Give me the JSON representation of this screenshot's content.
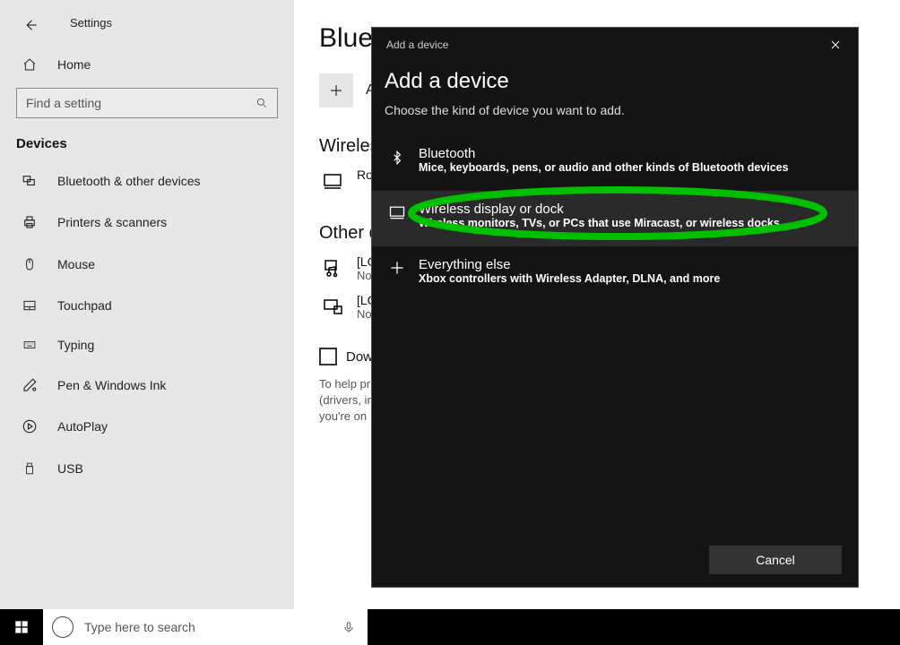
{
  "header": {
    "settings_label": "Settings",
    "home_label": "Home",
    "search_placeholder": "Find a setting",
    "section_label": "Devices"
  },
  "sidebar_items": [
    {
      "name": "bluetooth",
      "label": "Bluetooth & other devices",
      "icon": "bluetooth-mixed-icon"
    },
    {
      "name": "printers",
      "label": "Printers & scanners",
      "icon": "printer-icon"
    },
    {
      "name": "mouse",
      "label": "Mouse",
      "icon": "mouse-icon"
    },
    {
      "name": "touchpad",
      "label": "Touchpad",
      "icon": "touchpad-icon"
    },
    {
      "name": "typing",
      "label": "Typing",
      "icon": "keyboard-icon"
    },
    {
      "name": "pen",
      "label": "Pen & Windows Ink",
      "icon": "pen-icon"
    },
    {
      "name": "autoplay",
      "label": "AutoPlay",
      "icon": "autoplay-icon"
    },
    {
      "name": "usb",
      "label": "USB",
      "icon": "usb-icon"
    }
  ],
  "content": {
    "title_visible": "Blueto",
    "add_label": "Ad",
    "section_wireless": "Wireles",
    "device1_line1": "Ro",
    "section_other": "Other d",
    "device2_line1": "[LG",
    "device2_line2": "No",
    "device3_line1": "[LG",
    "device3_line2": "No",
    "checkbox_label": "Down",
    "help_text": "To help pr\n(drivers, in\nyou're on"
  },
  "dialog": {
    "title_small": "Add a device",
    "heading": "Add a device",
    "subheading": "Choose the kind of device you want to add.",
    "options": [
      {
        "name": "bluetooth",
        "title": "Bluetooth",
        "desc": "Mice, keyboards, pens, or audio and other kinds of Bluetooth devices",
        "icon": "bluetooth-icon",
        "selected": false
      },
      {
        "name": "wireless",
        "title": "Wireless display or dock",
        "desc": "Wireless monitors, TVs, or PCs that use Miracast, or wireless docks",
        "icon": "monitor-icon",
        "selected": true
      },
      {
        "name": "other",
        "title": "Everything else",
        "desc": "Xbox controllers with Wireless Adapter, DLNA, and more",
        "icon": "plus-icon",
        "selected": false
      }
    ],
    "cancel_label": "Cancel"
  },
  "taskbar": {
    "search_placeholder": "Type here to search"
  }
}
